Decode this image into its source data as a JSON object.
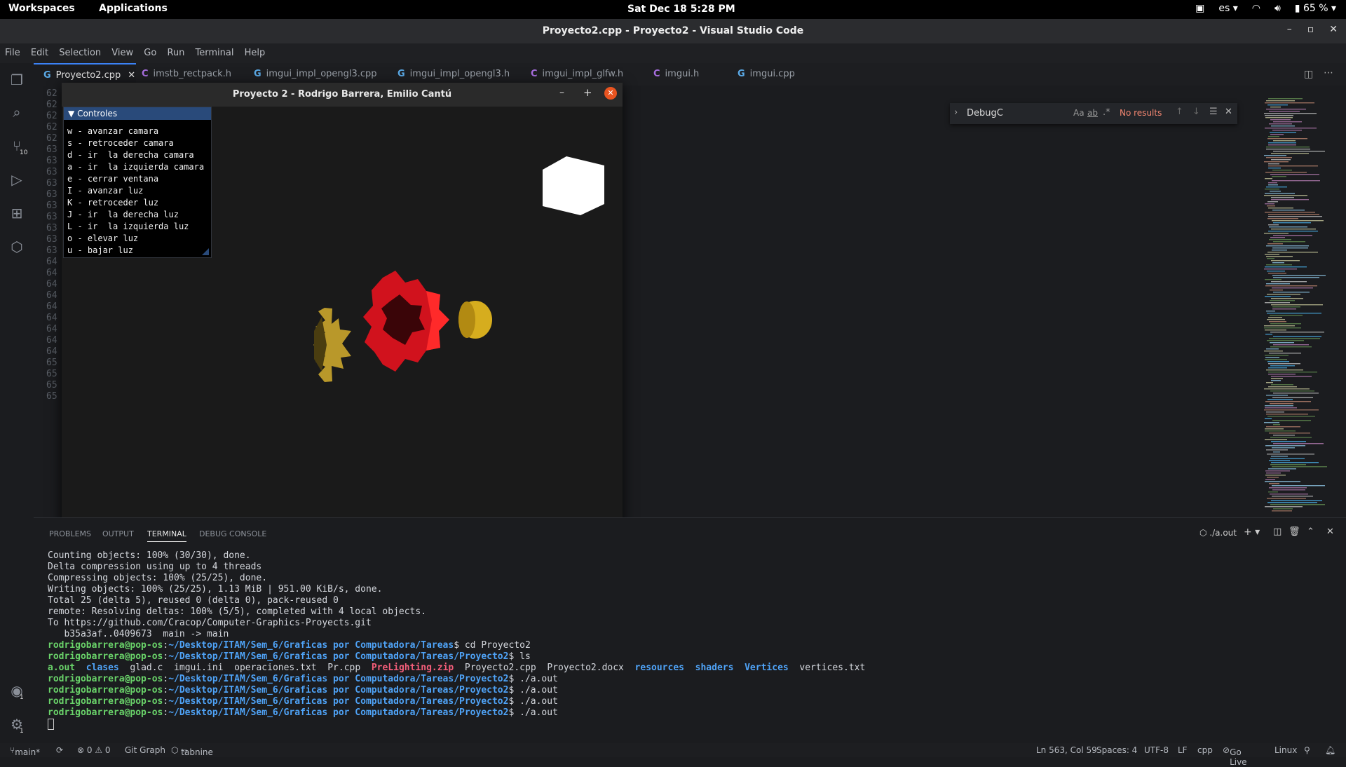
{
  "system_bar": {
    "workspaces": "Workspaces",
    "applications": "Applications",
    "clock": "Sat Dec 18   5:28 PM",
    "language": "es",
    "battery": "65 %"
  },
  "window": {
    "title": "Proyecto2.cpp - Proyecto2 - Visual Studio Code"
  },
  "menu": [
    "File",
    "Edit",
    "Selection",
    "View",
    "Go",
    "Run",
    "Terminal",
    "Help"
  ],
  "activity": {
    "scm_badge": "10",
    "accounts_badge": "1",
    "settings_badge": "1"
  },
  "tabs": [
    "Proyecto2.cpp",
    "imstb_rectpack.h",
    "imgui_impl_opengl3.cpp",
    "imgui_impl_opengl3.h",
    "imgui_impl_glfw.h",
    "imgui.h",
    "imgui.cpp"
  ],
  "editor": {
    "line_numbers": [
      "62",
      "62",
      "62",
      "62",
      "62",
      "63",
      "63",
      "63",
      "63",
      "63",
      "63",
      "63",
      "63",
      "63",
      "63",
      "64",
      "64",
      "64",
      "64",
      "64",
      "64",
      "64",
      "64",
      "64",
      "65",
      "65",
      "65",
      "65"
    ]
  },
  "find": {
    "query": "DebugC",
    "result": "No results",
    "opt_case": "Aa",
    "opt_word": "ab"
  },
  "gl_window": {
    "title": "Proyecto 2 - Rodrigo Barrera, Emilio Cantú",
    "imgui_header": "Controles",
    "controls": [
      "w - avanzar camara",
      "s - retroceder camara",
      "d - ir  la derecha camara",
      "a - ir  la izquierda camara",
      "e - cerrar ventana",
      "I - avanzar luz",
      "K - retroceder luz",
      "J - ir  la derecha luz",
      "L - ir  la izquierda luz",
      "o - elevar luz",
      "u - bajar luz"
    ]
  },
  "panel": {
    "tabs": [
      "PROBLEMS",
      "OUTPUT",
      "TERMINAL",
      "DEBUG CONSOLE"
    ],
    "terminal_name": "./a.out",
    "lines": [
      "Counting objects: 100% (30/30), done.",
      "Delta compression using up to 4 threads",
      "Compressing objects: 100% (25/25), done.",
      "Writing objects: 100% (25/25), 1.13 MiB | 951.00 KiB/s, done.",
      "Total 25 (delta 5), reused 0 (delta 0), pack-reused 0",
      "remote: Resolving deltas: 100% (5/5), completed with 4 local objects.",
      "To https://github.com/Cracop/Computer-Graphics-Proyects.git",
      "   b35a3af..0409673  main -> main"
    ],
    "prompt_user": "rodrigobarrera@pop-os",
    "prompt_path_tareas": "~/Desktop/ITAM/Sem_6/Graficas por Computadora/Tareas",
    "prompt_path_p2": "~/Desktop/ITAM/Sem_6/Graficas por Computadora/Tareas/Proyecto2",
    "cmd_cd": " cd Proyecto2",
    "cmd_ls": " ls",
    "cmd_run": " ./a.out",
    "ls_items": [
      {
        "name": "a.out",
        "kind": "exe"
      },
      {
        "name": "clases",
        "kind": "dir"
      },
      {
        "name": "glad.c",
        "kind": "file"
      },
      {
        "name": "imgui.ini",
        "kind": "file"
      },
      {
        "name": "operaciones.txt",
        "kind": "file"
      },
      {
        "name": "Pr.cpp",
        "kind": "file"
      },
      {
        "name": "PreLighting.zip",
        "kind": "zip"
      },
      {
        "name": "Proyecto2.cpp",
        "kind": "file"
      },
      {
        "name": "Proyecto2.docx",
        "kind": "file"
      },
      {
        "name": "resources",
        "kind": "dir"
      },
      {
        "name": "shaders",
        "kind": "dir"
      },
      {
        "name": "Vertices",
        "kind": "dir"
      },
      {
        "name": "vertices.txt",
        "kind": "file"
      }
    ]
  },
  "statusbar": {
    "branch": "main*",
    "problems": "⊗ 0 ⚠ 0",
    "git_graph": "Git Graph",
    "tabnine": "tabnine",
    "cursor": "Ln 563, Col 59",
    "spaces": "Spaces: 4",
    "encoding": "UTF-8",
    "eol": "LF",
    "language": "cpp",
    "golive": "Go Live",
    "os": "Linux"
  },
  "colors": {
    "accent": "#3b82f6",
    "prompt_green": "#6ad46a",
    "path_blue": "#4fa3f7",
    "zip_red": "#f45e7a",
    "imgui_header": "#294a7a",
    "close_orange": "#e95420"
  }
}
